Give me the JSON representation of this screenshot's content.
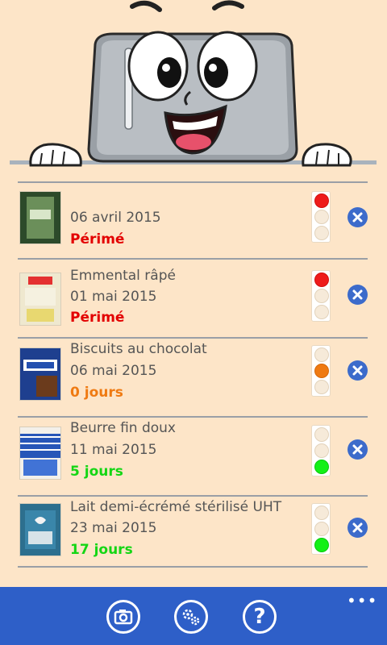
{
  "items": [
    {
      "name": "",
      "date": "06 avril 2015",
      "status": "Périmé",
      "status_color": "#e30000",
      "light": "red",
      "thumb": "green-jar"
    },
    {
      "name": "Emmental râpé",
      "date": "01 mai 2015",
      "status": "Périmé",
      "status_color": "#e30000",
      "light": "red",
      "thumb": "cheese-bag"
    },
    {
      "name": "Biscuits au chocolat",
      "date": "06 mai 2015",
      "status": "0 jours",
      "status_color": "#ef7a12",
      "light": "orange",
      "thumb": "prince-box"
    },
    {
      "name": "Beurre fin doux",
      "date": "11 mai 2015",
      "status": "5 jours",
      "status_color": "#14d614",
      "light": "green",
      "thumb": "butter-pack"
    },
    {
      "name": "Lait demi-écrémé stérilisé UHT",
      "date": "23 mai 2015",
      "status": "17 jours",
      "status_color": "#14d614",
      "light": "green",
      "thumb": "milk-carton"
    }
  ],
  "appbar": {
    "buttons": [
      "camera-icon",
      "settings-icon",
      "help-icon"
    ],
    "help_glyph": "?",
    "more_glyph": "•••"
  },
  "colors": {
    "background": "#fde5c8",
    "appbar": "#2e5fc8",
    "delete": "#3c6bcb"
  }
}
